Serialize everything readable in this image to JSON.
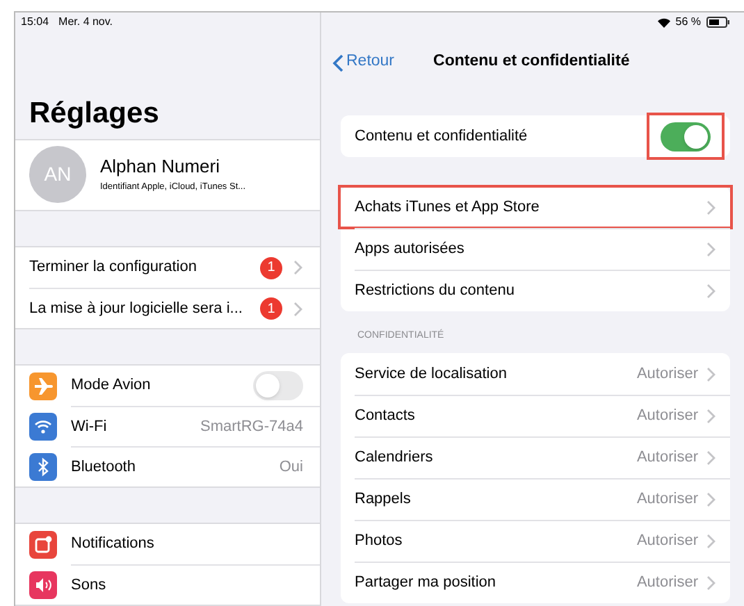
{
  "status_bar": {
    "time": "15:04",
    "date": "Mer. 4 nov.",
    "battery": "56 %"
  },
  "sidebar": {
    "title": "Réglages",
    "profile": {
      "initials": "AN",
      "name": "Alphan Numeri",
      "subtitle": "Identifiant Apple, iCloud, iTunes St..."
    },
    "groups": [
      {
        "items": [
          {
            "kind": "badge",
            "label": "Terminer la configuration",
            "badge": "1"
          },
          {
            "kind": "badge",
            "label": "La mise à jour logicielle sera i...",
            "badge": "1"
          }
        ]
      },
      {
        "items": [
          {
            "kind": "toggle",
            "label": "Mode Avion",
            "color": "#f7962e",
            "on": false
          },
          {
            "kind": "value",
            "label": "Wi-Fi",
            "color": "#3b7ad3",
            "value": "SmartRG-74a4"
          },
          {
            "kind": "value",
            "label": "Bluetooth",
            "color": "#3b7ad3",
            "value": "Oui"
          }
        ]
      },
      {
        "items": [
          {
            "kind": "plain",
            "label": "Notifications",
            "color": "#e8453c"
          },
          {
            "kind": "plain",
            "label": "Sons",
            "color": "#e7365f"
          }
        ]
      }
    ]
  },
  "detail": {
    "back": "Retour",
    "title": "Contenu et confidentialité",
    "sections": [
      {
        "items": [
          {
            "kind": "toggle",
            "label": "Contenu et confidentialité",
            "on": true,
            "highlighted": true
          }
        ]
      },
      {
        "items": [
          {
            "kind": "link",
            "label": "Achats iTunes et App Store",
            "highlighted": true
          },
          {
            "kind": "link",
            "label": "Apps autorisées",
            "highlighted": false
          },
          {
            "kind": "link",
            "label": "Restrictions du contenu",
            "highlighted": false
          }
        ]
      },
      {
        "header": "CONFIDENTIALITÉ",
        "items": [
          {
            "kind": "link",
            "label": "Service de localisation",
            "value": "Autoriser"
          },
          {
            "kind": "link",
            "label": "Contacts",
            "value": "Autoriser"
          },
          {
            "kind": "link",
            "label": "Calendriers",
            "value": "Autoriser"
          },
          {
            "kind": "link",
            "label": "Rappels",
            "value": "Autoriser"
          },
          {
            "kind": "link",
            "label": "Photos",
            "value": "Autoriser"
          },
          {
            "kind": "link",
            "label": "Partager ma position",
            "value": "Autoriser"
          }
        ]
      }
    ]
  }
}
